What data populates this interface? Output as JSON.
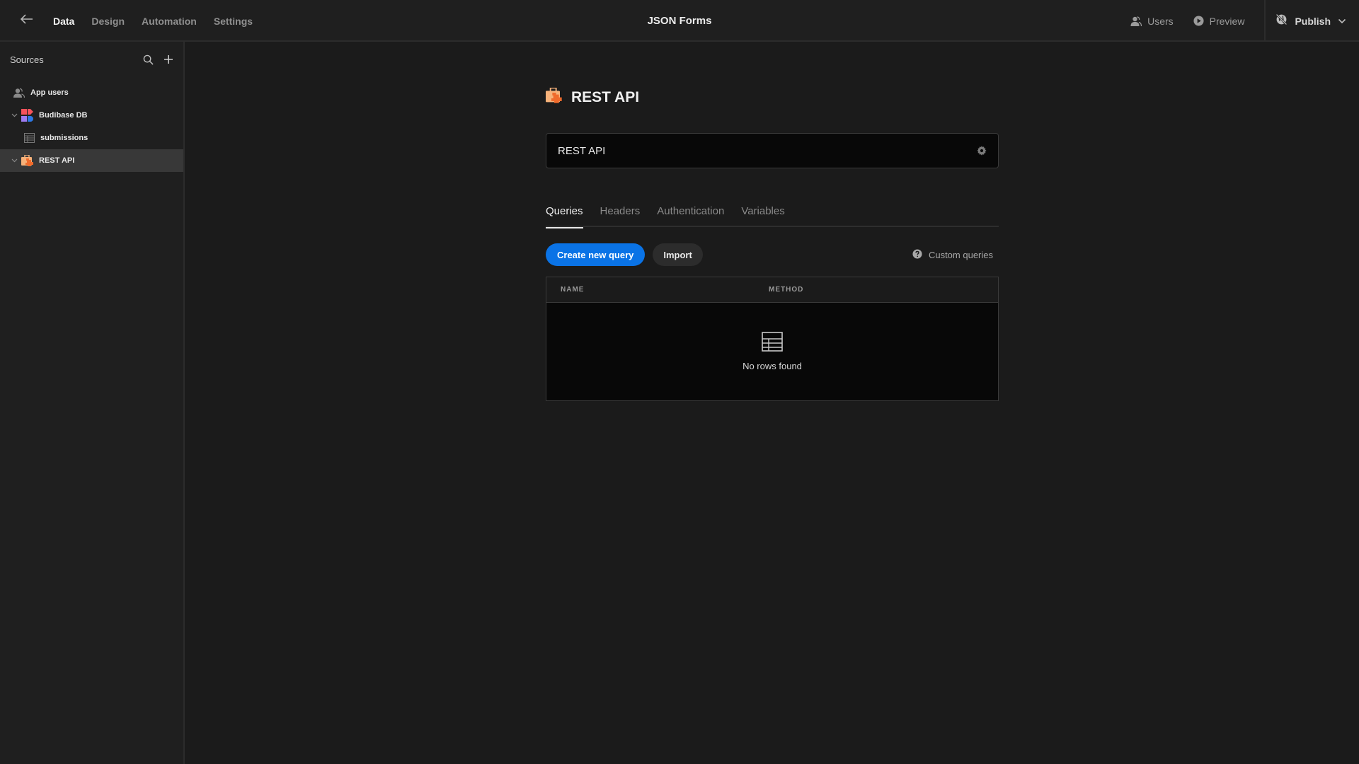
{
  "topbar": {
    "back_icon": "arrow-left-icon",
    "tabs": [
      {
        "label": "Data",
        "active": true
      },
      {
        "label": "Design",
        "active": false
      },
      {
        "label": "Automation",
        "active": false
      },
      {
        "label": "Settings",
        "active": false
      }
    ],
    "app_title": "JSON Forms",
    "users_label": "Users",
    "preview_label": "Preview",
    "publish_label": "Publish"
  },
  "sidebar": {
    "title": "Sources",
    "items": [
      {
        "label": "App users",
        "icon": "user-group-icon",
        "level": 0,
        "expandable": false,
        "selected": false
      },
      {
        "label": "Budibase DB",
        "icon": "budibase-db-icon",
        "level": 0,
        "expandable": true,
        "selected": false
      },
      {
        "label": "submissions",
        "icon": "table-icon",
        "level": 1,
        "expandable": false,
        "selected": false
      },
      {
        "label": "REST API",
        "icon": "rest-api-icon",
        "level": 0,
        "expandable": true,
        "selected": true
      }
    ]
  },
  "main": {
    "datasource_title": "REST API",
    "name_field_value": "REST API",
    "tabs": [
      {
        "label": "Queries",
        "active": true
      },
      {
        "label": "Headers",
        "active": false
      },
      {
        "label": "Authentication",
        "active": false
      },
      {
        "label": "Variables",
        "active": false
      }
    ],
    "create_query_label": "Create new query",
    "import_label": "Import",
    "custom_queries_label": "Custom queries",
    "table": {
      "columns": [
        "NAME",
        "METHOD"
      ],
      "rows": [],
      "empty_text": "No rows found"
    }
  },
  "colors": {
    "accent": "#0a73e6",
    "rest_api_orange": "#f06b2c",
    "budibase_red": "#f5525b",
    "budibase_purple": "#9d7bf0",
    "budibase_blue": "#2c78e6"
  }
}
